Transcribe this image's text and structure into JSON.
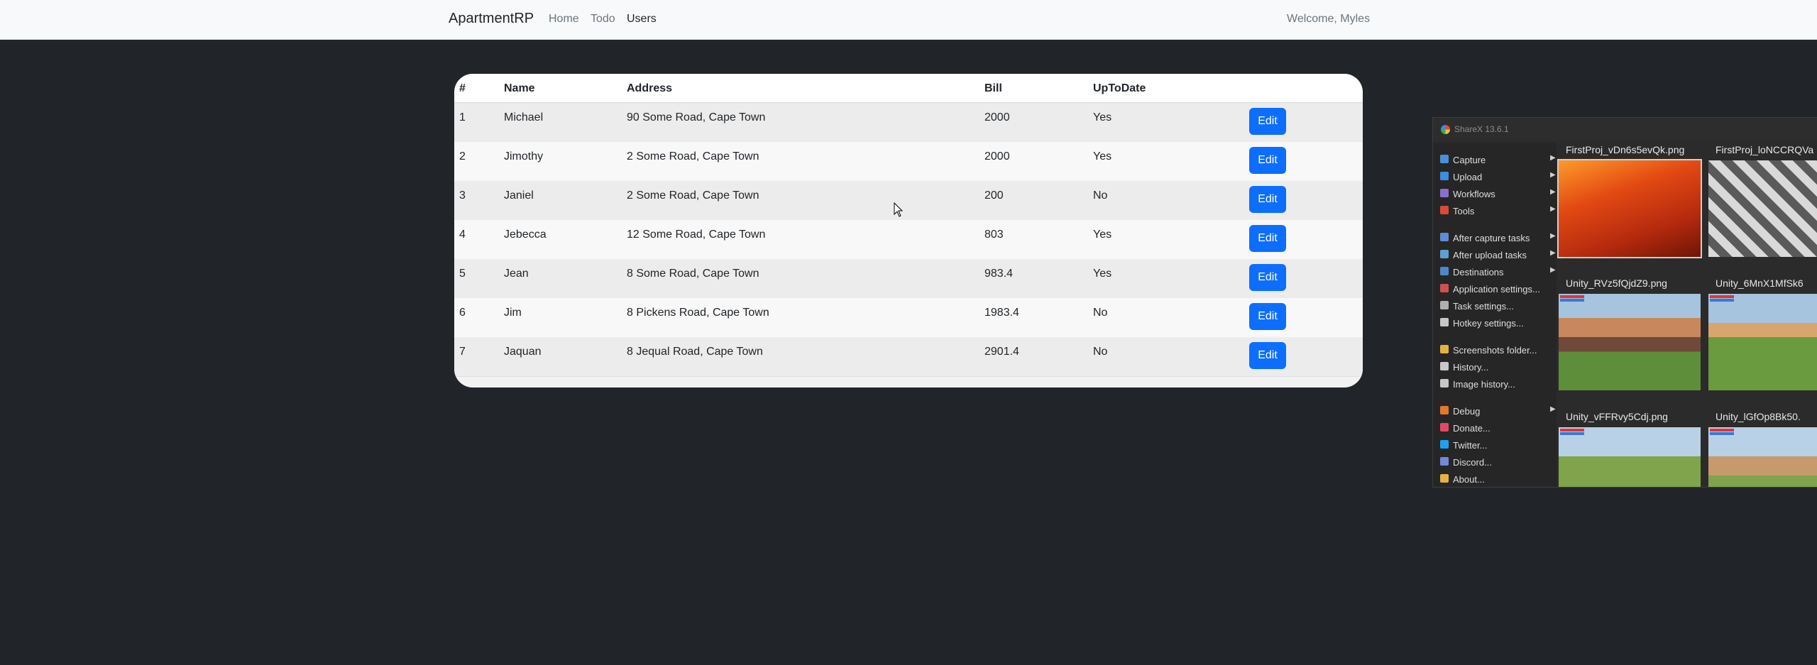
{
  "navbar": {
    "brand": "ApartmentRP",
    "links": [
      {
        "label": "Home",
        "active": false
      },
      {
        "label": "Todo",
        "active": false
      },
      {
        "label": "Users",
        "active": true
      }
    ],
    "welcome": "Welcome, Myles"
  },
  "table": {
    "headers": [
      "#",
      "Name",
      "Address",
      "Bill",
      "UpToDate",
      ""
    ],
    "rows": [
      {
        "id": "1",
        "name": "Michael",
        "address": "90 Some Road, Cape Town",
        "bill": "2000",
        "uptodate": "Yes",
        "action": "Edit"
      },
      {
        "id": "2",
        "name": "Jimothy",
        "address": "2 Some Road, Cape Town",
        "bill": "2000",
        "uptodate": "Yes",
        "action": "Edit"
      },
      {
        "id": "3",
        "name": "Janiel",
        "address": "2 Some Road, Cape Town",
        "bill": "200",
        "uptodate": "No",
        "action": "Edit"
      },
      {
        "id": "4",
        "name": "Jebecca",
        "address": "12 Some Road, Cape Town",
        "bill": "803",
        "uptodate": "Yes",
        "action": "Edit"
      },
      {
        "id": "5",
        "name": "Jean",
        "address": "8 Some Road, Cape Town",
        "bill": "983.4",
        "uptodate": "Yes",
        "action": "Edit"
      },
      {
        "id": "6",
        "name": "Jim",
        "address": "8 Pickens Road, Cape Town",
        "bill": "1983.4",
        "uptodate": "No",
        "action": "Edit"
      },
      {
        "id": "7",
        "name": "Jaquan",
        "address": "8 Jequal Road, Cape Town",
        "bill": "2901.4",
        "uptodate": "No",
        "action": "Edit"
      }
    ],
    "accent": "#0d6efd"
  },
  "sharex": {
    "title": "ShareX 13.6.1",
    "menu": [
      {
        "label": "Capture",
        "icon": "capture-icon",
        "color": "#4a90d9",
        "submenu": true
      },
      {
        "label": "Upload",
        "icon": "upload-icon",
        "color": "#3a8de0",
        "submenu": true
      },
      {
        "label": "Workflows",
        "icon": "workflows-icon",
        "color": "#8a6fd0",
        "submenu": true
      },
      {
        "label": "Tools",
        "icon": "tools-icon",
        "color": "#d94a3a",
        "submenu": true
      },
      {
        "label": "After capture tasks",
        "icon": "after-capture-icon",
        "color": "#5b8fd1",
        "submenu": true
      },
      {
        "label": "After upload tasks",
        "icon": "after-upload-icon",
        "color": "#5ba0d1",
        "submenu": true
      },
      {
        "label": "Destinations",
        "icon": "destinations-icon",
        "color": "#4f86c9",
        "submenu": true
      },
      {
        "label": "Application settings...",
        "icon": "application-settings-icon",
        "color": "#d05050",
        "submenu": false
      },
      {
        "label": "Task settings...",
        "icon": "task-settings-icon",
        "color": "#b0b0b0",
        "submenu": false
      },
      {
        "label": "Hotkey settings...",
        "icon": "hotkey-settings-icon",
        "color": "#c8c8c8",
        "submenu": false
      },
      {
        "label": "Screenshots folder...",
        "icon": "screenshots-folder-icon",
        "color": "#e3b341",
        "submenu": false
      },
      {
        "label": "History...",
        "icon": "history-icon",
        "color": "#c8c8c8",
        "submenu": false
      },
      {
        "label": "Image history...",
        "icon": "image-history-icon",
        "color": "#c8c8c8",
        "submenu": false
      },
      {
        "label": "Debug",
        "icon": "debug-icon",
        "color": "#e07a2a",
        "submenu": true
      },
      {
        "label": "Donate...",
        "icon": "donate-icon",
        "color": "#e04868",
        "submenu": false
      },
      {
        "label": "Twitter...",
        "icon": "twitter-icon",
        "color": "#1da1f2",
        "submenu": false
      },
      {
        "label": "Discord...",
        "icon": "discord-icon",
        "color": "#7289da",
        "submenu": false
      },
      {
        "label": "About...",
        "icon": "about-icon",
        "color": "#e3b341",
        "submenu": false
      }
    ],
    "thumbnails": [
      {
        "caption": "FirstProj_vDn6s5evQk.png",
        "style": "t-fire",
        "selected": true
      },
      {
        "caption": "FirstProj_loNCCRQVa",
        "style": "t-board",
        "selected": false
      },
      {
        "caption": "Unity_RVz5fQjdZ9.png",
        "style": "t-town1",
        "selected": false
      },
      {
        "caption": "Unity_6MnX1MfSk6",
        "style": "t-town2",
        "selected": false
      },
      {
        "caption": "Unity_vFFRvy5Cdj.png",
        "style": "t-town3",
        "selected": false
      },
      {
        "caption": "Unity_lGfOp8Bk50.",
        "style": "t-town4",
        "selected": false
      }
    ]
  }
}
